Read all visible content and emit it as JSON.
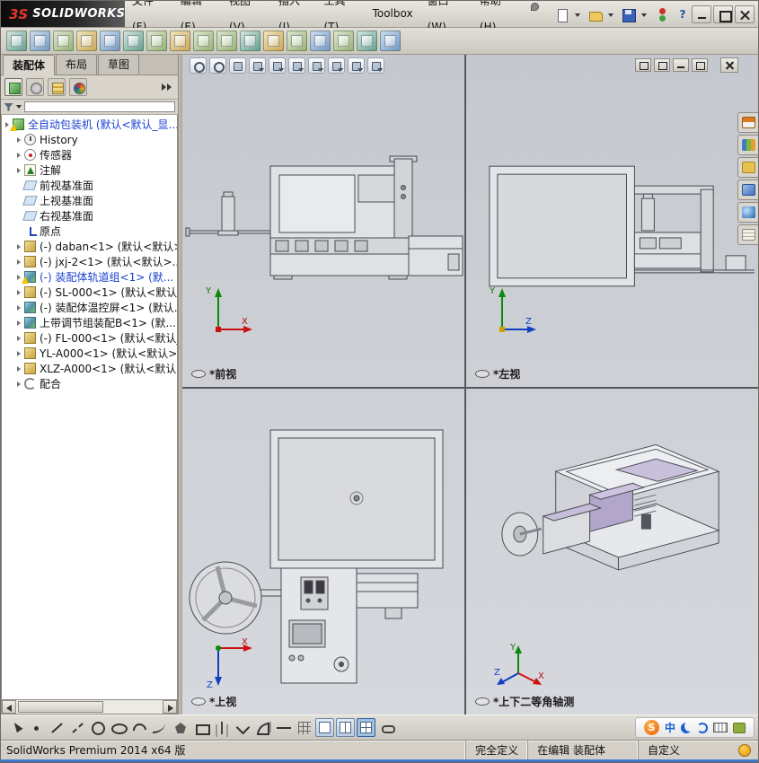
{
  "titlebar": {
    "brand_mark": "3S",
    "brand": "SOLIDWORKS",
    "menus": [
      "文件(F)",
      "编辑(E)",
      "视图(V)",
      "插入(I)",
      "工具(T)",
      "Toolbox",
      "窗口(W)",
      "帮助(H)"
    ],
    "help_glyph": "?"
  },
  "assembly_toolbar": [
    "insert-component-icon",
    "mate-icon",
    "linear-component-pattern-icon",
    "smart-fasteners-icon",
    "move-component-icon",
    "show-hidden-components-icon",
    "assembly-features-icon",
    "reference-geometry-icon",
    "new-motion-study-icon",
    "bill-of-materials-icon",
    "exploded-view-icon",
    "interference-detection-icon",
    "measure-icon",
    "mass-properties-icon",
    "section-view-icon",
    "simulation-icon",
    "instant3d-icon"
  ],
  "panel": {
    "tabs": [
      {
        "label": "装配体",
        "cls": "active"
      },
      {
        "label": "布局",
        "cls": ""
      },
      {
        "label": "草图",
        "cls": ""
      }
    ],
    "tree": [
      {
        "label": "全自动包装机 (默认<默认_显...",
        "cls": "ic-root warn blue"
      },
      {
        "label": "History",
        "cls": "ic-history d1"
      },
      {
        "label": "传感器",
        "cls": "ic-sensor d1"
      },
      {
        "label": "注解",
        "cls": "ic-annot d1"
      },
      {
        "label": "前视基准面",
        "cls": "ic-plane d1 noarrow"
      },
      {
        "label": "上视基准面",
        "cls": "ic-plane d1 noarrow"
      },
      {
        "label": "右视基准面",
        "cls": "ic-plane d1 noarrow"
      },
      {
        "label": "原点",
        "cls": "ic-origin d1 noarrow"
      },
      {
        "label": "(-) daban<1> (默认<默认>...",
        "cls": "ic-comp d1"
      },
      {
        "label": "(-) jxj-2<1> (默认<默认>...",
        "cls": "ic-comp d1"
      },
      {
        "label": "(-) 装配体轨道组<1> (默...",
        "cls": "ic-asm d1 warn blue"
      },
      {
        "label": "(-) SL-000<1> (默认<默认_...",
        "cls": "ic-comp d1"
      },
      {
        "label": "(-) 装配体温控屏<1> (默认...",
        "cls": "ic-asm d1"
      },
      {
        "label": "上带调节组装配B<1> (默...",
        "cls": "ic-asm d1"
      },
      {
        "label": "(-) FL-000<1> (默认<默认_...",
        "cls": "ic-comp d1"
      },
      {
        "label": "YL-A000<1> (默认<默认>...",
        "cls": "ic-comp d1"
      },
      {
        "label": "XLZ-A000<1> (默认<默认...",
        "cls": "ic-comp d1"
      },
      {
        "label": "配合",
        "cls": "ic-mates d1"
      }
    ]
  },
  "view_toolbar": [
    "zoom-to-fit-icon",
    "zoom-to-area-icon",
    "previous-view-icon",
    "section-view-icon",
    "view-orientation-icon",
    "display-style-icon",
    "hide-show-items-icon",
    "edit-appearance-icon",
    "apply-scene-icon",
    "view-settings-icon"
  ],
  "taskpane": [
    "solidworks-resources-icon",
    "design-library-icon",
    "file-explorer-icon",
    "view-palette-icon",
    "appearances-scenes-icon",
    "custom-properties-icon"
  ],
  "viewports": [
    {
      "label": "*前视"
    },
    {
      "label": "*左视"
    },
    {
      "label": "*上视"
    },
    {
      "label": "*上下二等角轴测"
    }
  ],
  "triad": {
    "x": "X",
    "y": "Y",
    "z": "Z"
  },
  "sketch_toolbar": [
    "select-icon",
    "sketch-point-icon",
    "sketch-line-icon",
    "centerline-icon",
    "sketch-circle-icon",
    "sketch-ellipse-icon",
    "sketch-arc-icon",
    "sketch-spline-icon",
    "sketch-polygon-icon",
    "sketch-rectangle-icon",
    "mirror-entities-icon",
    "trim-entities-icon",
    "offset-entities-icon",
    "smart-dimension-icon",
    "grid-snap-icon",
    "single-view-icon",
    "two-view-icon",
    "four-view-icon",
    "link-views-icon"
  ],
  "ime": {
    "logo": "S",
    "lang": "中"
  },
  "statusbar": {
    "app": "SolidWorks Premium 2014 x64 版",
    "defined": "完全定义",
    "editing": "在编辑 装配体",
    "custom": "自定义"
  }
}
